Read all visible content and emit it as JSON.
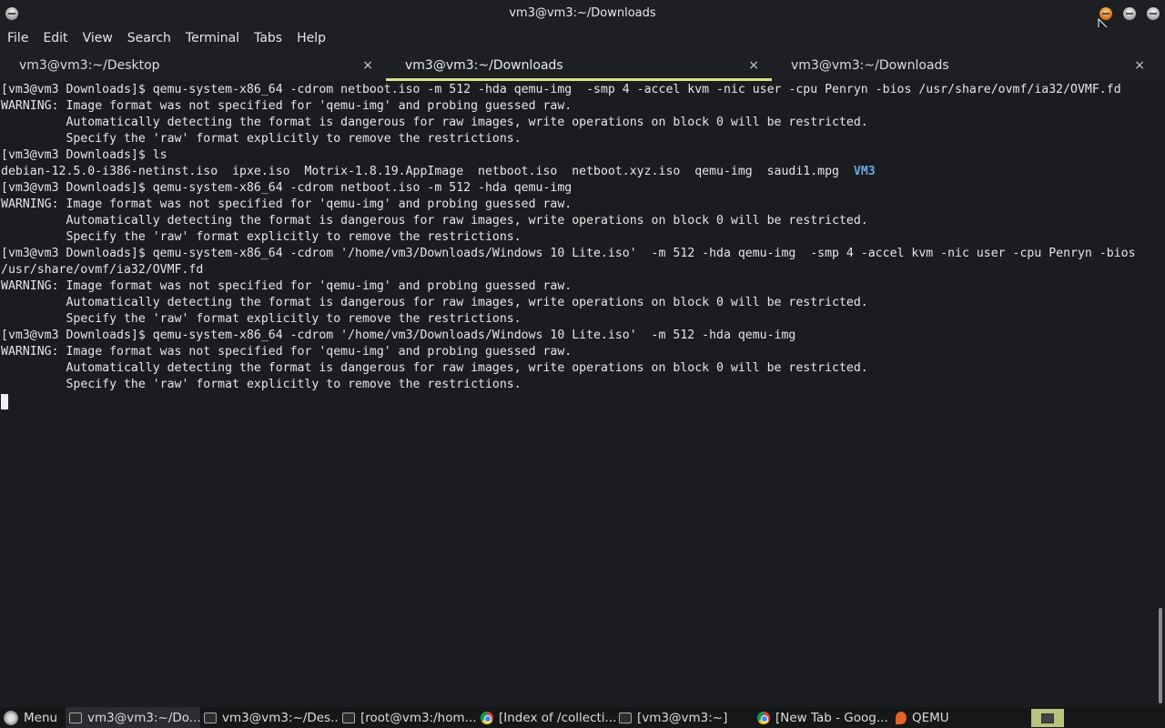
{
  "window": {
    "title": "vm3@vm3:~/Downloads"
  },
  "menubar": {
    "items": [
      "File",
      "Edit",
      "View",
      "Search",
      "Terminal",
      "Tabs",
      "Help"
    ]
  },
  "tabs": [
    {
      "label": "vm3@vm3:~/Desktop",
      "close": "×"
    },
    {
      "label": "vm3@vm3:~/Downloads",
      "close": "×"
    },
    {
      "label": "vm3@vm3:~/Downloads",
      "close": "×"
    }
  ],
  "terminal": {
    "lines": [
      "[vm3@vm3 Downloads]$ qemu-system-x86_64 -cdrom netboot.iso -m 512 -hda qemu-img  -smp 4 -accel kvm -nic user -cpu Penryn -bios /usr/share/ovmf/ia32/OVMF.fd",
      "WARNING: Image format was not specified for 'qemu-img' and probing guessed raw.",
      "         Automatically detecting the format is dangerous for raw images, write operations on block 0 will be restricted.",
      "         Specify the 'raw' format explicitly to remove the restrictions.",
      "[vm3@vm3 Downloads]$ ls",
      "debian-12.5.0-i386-netinst.iso  ipxe.iso  Motrix-1.8.19.AppImage  netboot.iso  netboot.xyz.iso  qemu-img  saudi1.mpg  ",
      "[vm3@vm3 Downloads]$ qemu-system-x86_64 -cdrom netboot.iso -m 512 -hda qemu-img",
      "WARNING: Image format was not specified for 'qemu-img' and probing guessed raw.",
      "         Automatically detecting the format is dangerous for raw images, write operations on block 0 will be restricted.",
      "         Specify the 'raw' format explicitly to remove the restrictions.",
      "[vm3@vm3 Downloads]$ qemu-system-x86_64 -cdrom '/home/vm3/Downloads/Windows 10 Lite.iso'  -m 512 -hda qemu-img  -smp 4 -accel kvm -nic user -cpu Penryn -bios",
      "/usr/share/ovmf/ia32/OVMF.fd",
      "WARNING: Image format was not specified for 'qemu-img' and probing guessed raw.",
      "         Automatically detecting the format is dangerous for raw images, write operations on block 0 will be restricted.",
      "         Specify the 'raw' format explicitly to remove the restrictions.",
      "[vm3@vm3 Downloads]$ qemu-system-x86_64 -cdrom '/home/vm3/Downloads/Windows 10 Lite.iso'  -m 512 -hda qemu-img",
      "WARNING: Image format was not specified for 'qemu-img' and probing guessed raw.",
      "         Automatically detecting the format is dangerous for raw images, write operations on block 0 will be restricted.",
      "         Specify the 'raw' format explicitly to remove the restrictions."
    ],
    "ls_dir_entry": "VM3",
    "dir_color": "#6ea6e6"
  },
  "taskbar": {
    "menu_label": "Menu",
    "tasks": [
      {
        "label": "vm3@vm3:~/Do...",
        "icon": "terminal-icon"
      },
      {
        "label": "vm3@vm3:~/Des...",
        "icon": "terminal-icon"
      },
      {
        "label": "[root@vm3:/hom...",
        "icon": "terminal-icon"
      },
      {
        "label": "[Index of /collecti...",
        "icon": "chrome-icon"
      },
      {
        "label": "[vm3@vm3:~]",
        "icon": "window-icon"
      },
      {
        "label": "[New Tab - Goog...",
        "icon": "chrome-icon"
      },
      {
        "label": "QEMU",
        "icon": "qemu-icon"
      }
    ]
  },
  "colors": {
    "accent_tab_underline": "#d8e08a",
    "tray_highlight": "#b9c37d"
  }
}
